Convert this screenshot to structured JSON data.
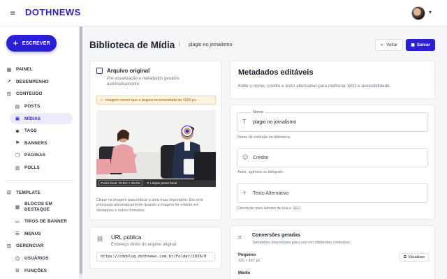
{
  "brand": {
    "logo": "DOTHNEWS",
    "menu_icon": "hamburger-icon",
    "accent": "#2b1fd6"
  },
  "sidebar": {
    "write_label": "ESCREVER",
    "items": [
      {
        "label": "PAINEL",
        "icon": "grid-icon"
      },
      {
        "label": "DESEMPENHO",
        "icon": "trend-icon"
      },
      {
        "label": "CONTEÚDO",
        "icon": "collapse-icon"
      },
      {
        "label": "POSTS",
        "icon": "document-icon"
      },
      {
        "label": "MÍDIAS",
        "icon": "image-icon"
      },
      {
        "label": "TAGS",
        "icon": "tag-icon"
      },
      {
        "label": "BANNERS",
        "icon": "flag-icon"
      },
      {
        "label": "PÁGINAS",
        "icon": "pages-icon"
      },
      {
        "label": "POLLS",
        "icon": "poll-icon"
      },
      {
        "label": "TEMPLATE",
        "icon": "collapse-icon"
      },
      {
        "label": "BLOCOS EM DESTAQUE",
        "icon": "blocks-icon"
      },
      {
        "label": "TIPOS DE BANNER",
        "icon": "banner-type-icon"
      },
      {
        "label": "MENUS",
        "icon": "menu-icon"
      },
      {
        "label": "GERENCIAR",
        "icon": "collapse-icon"
      },
      {
        "label": "USUÁRIOS",
        "icon": "users-icon"
      },
      {
        "label": "FUNÇÕES",
        "icon": "roles-icon"
      }
    ]
  },
  "header": {
    "title": "Biblioteca de Mídia",
    "separator": "/",
    "breadcrumb": "plagio no jornalismo",
    "back_label": "Voltar",
    "save_label": "Salvar"
  },
  "original": {
    "title": "Arquivo original",
    "subtitle": "Pré-visualização e metadados gerados automaticamente.",
    "warning": "Imagem menor que a largura recomendada de 1920 px.",
    "focal_label": "Ponto focal: 75.9% × 26.9%",
    "clear_focal_label": "Limpar ponto focal",
    "hint": "Clique na imagem para indicar a área mais importante. Ela será priorizada automaticamente quando a imagem for exibida em destaques e outros formatos.",
    "focal_x": 0.759,
    "focal_y": 0.269
  },
  "public_url": {
    "title": "URL pública",
    "subtitle": "Endereço direto do arquivo original.",
    "value": "https://cdnblog.dothnews.com.br/Folder/2026/0"
  },
  "metadata": {
    "title": "Metadados editáveis",
    "subtitle": "Edite o nome, crédito e texto alternativo para melhorar SEO e acessibilidade.",
    "name_label": "Nome",
    "name_value": "plagio no jornalismo",
    "name_help": "Nome de exibição na biblioteca.",
    "credit_placeholder": "Crédito",
    "credit_help": "Autor, agência ou fotógrafo.",
    "alt_placeholder": "Texto Alternativo",
    "alt_help": "Descrição para leitores de tela e SEO."
  },
  "conversions": {
    "title": "Conversões geradas",
    "subtitle": "Tamanhos disponíveis para uso em diferentes contextos.",
    "items": [
      {
        "name": "Pequeno",
        "size": "320 × 167 px",
        "action": "Visualizar"
      },
      {
        "name": "Médio",
        "size": "",
        "action": ""
      }
    ]
  }
}
